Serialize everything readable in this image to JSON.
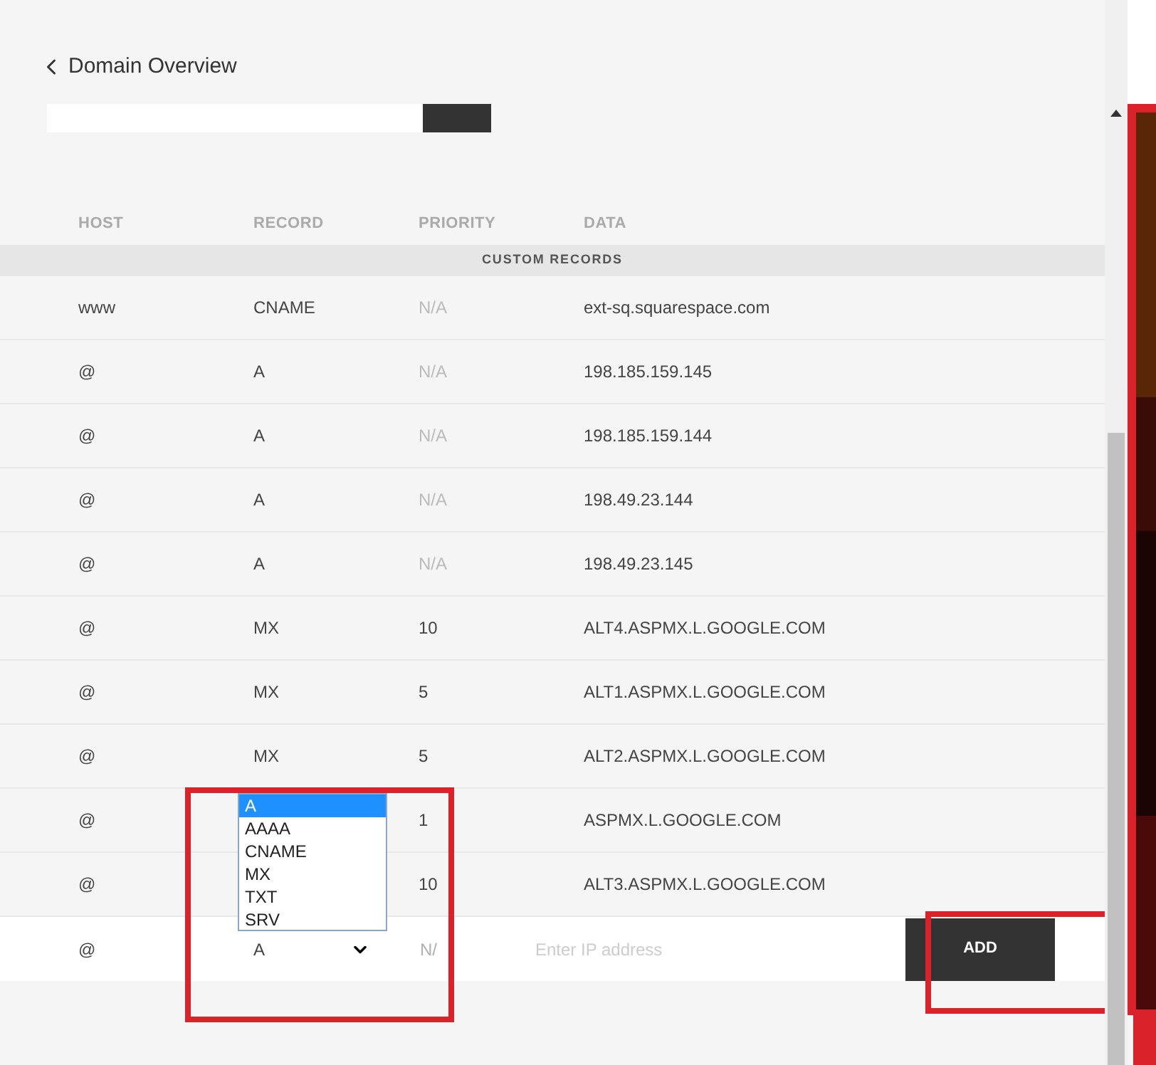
{
  "back_link": "Domain Overview",
  "columns": [
    "HOST",
    "RECORD",
    "PRIORITY",
    "DATA"
  ],
  "section_label": "CUSTOM RECORDS",
  "rows": [
    {
      "host": "www",
      "record": "CNAME",
      "priority": "N/A",
      "data": "ext-sq.squarespace.com"
    },
    {
      "host": "@",
      "record": "A",
      "priority": "N/A",
      "data": "198.185.159.145"
    },
    {
      "host": "@",
      "record": "A",
      "priority": "N/A",
      "data": "198.185.159.144"
    },
    {
      "host": "@",
      "record": "A",
      "priority": "N/A",
      "data": "198.49.23.144"
    },
    {
      "host": "@",
      "record": "A",
      "priority": "N/A",
      "data": "198.49.23.145"
    },
    {
      "host": "@",
      "record": "MX",
      "priority": "10",
      "data": "ALT4.ASPMX.L.GOOGLE.COM"
    },
    {
      "host": "@",
      "record": "MX",
      "priority": "5",
      "data": "ALT1.ASPMX.L.GOOGLE.COM"
    },
    {
      "host": "@",
      "record": "MX",
      "priority": "5",
      "data": "ALT2.ASPMX.L.GOOGLE.COM"
    },
    {
      "host": "@",
      "priority": "1",
      "data": "ASPMX.L.GOOGLE.COM"
    },
    {
      "host": "@",
      "priority": "10",
      "data": "ALT3.ASPMX.L.GOOGLE.COM"
    }
  ],
  "new_record": {
    "host": "@",
    "record": "A",
    "priority": "N/",
    "data_placeholder": "Enter IP address",
    "add_button": "ADD"
  },
  "record_options": [
    {
      "label": "A",
      "selected": true
    },
    {
      "label": "AAAA",
      "selected": false
    },
    {
      "label": "CNAME",
      "selected": false
    },
    {
      "label": "MX",
      "selected": false
    },
    {
      "label": "TXT",
      "selected": false
    },
    {
      "label": "SRV",
      "selected": false
    }
  ]
}
